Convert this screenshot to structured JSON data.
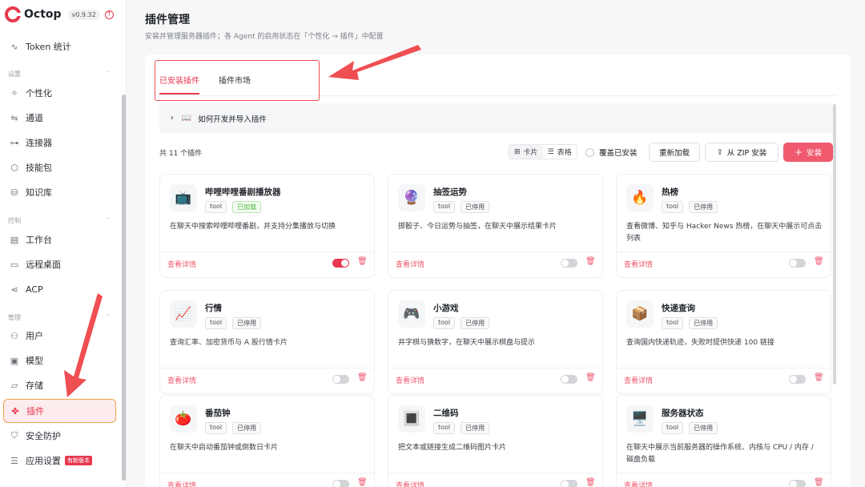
{
  "app": {
    "name": "Octop",
    "version": "v0.9.32"
  },
  "sidebar": {
    "token_item": {
      "label": "Token 统计",
      "icon": "activity-icon"
    },
    "groups": {
      "settings": "设置",
      "control": "控制",
      "manage": "管理"
    },
    "settings_items": [
      {
        "label": "个性化",
        "icon": "sparkle-icon"
      },
      {
        "label": "通道",
        "icon": "route-icon"
      },
      {
        "label": "连接器",
        "icon": "link-icon"
      },
      {
        "label": "技能包",
        "icon": "box-icon"
      },
      {
        "label": "知识库",
        "icon": "database-icon"
      }
    ],
    "control_items": [
      {
        "label": "工作台",
        "icon": "layout-icon"
      },
      {
        "label": "远程桌面",
        "icon": "monitor-icon"
      },
      {
        "label": "ACP",
        "icon": "share-icon"
      }
    ],
    "manage_items": [
      {
        "label": "用户",
        "icon": "users-icon"
      },
      {
        "label": "模型",
        "icon": "cube-icon"
      },
      {
        "label": "存储",
        "icon": "folder-icon"
      },
      {
        "label": "插件",
        "icon": "puzzle-icon"
      },
      {
        "label": "安全防护",
        "icon": "shield-icon"
      },
      {
        "label": "应用设置",
        "icon": "sliders-icon"
      }
    ],
    "new_version_badge": "有新版本"
  },
  "page": {
    "title": "插件管理",
    "subtitle": "安装并管理服务器插件；各 Agent 的启用状态在「个性化 → 插件」中配置"
  },
  "tabs": [
    "已安装插件",
    "插件市场"
  ],
  "howto": "如何开发并导入插件",
  "toolbar": {
    "count": "共 11 个插件",
    "view_card": "卡片",
    "view_table": "表格",
    "overwrite": "覆盖已安装",
    "reload": "重新加载",
    "zip_install": "从 ZIP 安装",
    "install": "安装"
  },
  "card_common": {
    "detail": "查看详情",
    "tool": "tool"
  },
  "plugins": [
    {
      "emoji": "📺",
      "name": "哔哩哔哩番剧播放器",
      "status": "已加载",
      "enabled": true,
      "desc": "在聊天中搜索哔哩哔哩番剧，并支持分集播放与切换"
    },
    {
      "emoji": "🔮",
      "name": "抽签运势",
      "status": "已停用",
      "enabled": false,
      "desc": "掷骰子、今日运势与抽签，在聊天中展示结果卡片"
    },
    {
      "emoji": "🔥",
      "name": "热榜",
      "status": "已停用",
      "enabled": false,
      "desc": "查看微博、知乎与 Hacker News 热榜，在聊天中展示可点击列表"
    },
    {
      "emoji": "📈",
      "name": "行情",
      "status": "已停用",
      "enabled": false,
      "desc": "查询汇率、加密货币与 A 股行情卡片"
    },
    {
      "emoji": "🎮",
      "name": "小游戏",
      "status": "已停用",
      "enabled": false,
      "desc": "井字棋与猜数字，在聊天中展示棋盘与提示"
    },
    {
      "emoji": "📦",
      "name": "快递查询",
      "status": "已停用",
      "enabled": false,
      "desc": "查询国内快递轨迹，失败时提供快递 100 链接"
    },
    {
      "emoji": "🍅",
      "name": "番茄钟",
      "status": "已停用",
      "enabled": false,
      "desc": "在聊天中启动番茄钟或倒数日卡片"
    },
    {
      "emoji": "🔳",
      "name": "二维码",
      "status": "已停用",
      "enabled": false,
      "desc": "把文本或链接生成二维码图片卡片"
    },
    {
      "emoji": "🖥️",
      "name": "服务器状态",
      "status": "已停用",
      "enabled": false,
      "desc": "在聊天中展示当前服务器的操作系统、内核与 CPU / 内存 / 磁盘负载"
    }
  ],
  "colors": {
    "accent": "#e7384e",
    "annotation": "#ef4e52",
    "highlight_border": "#f0a046"
  }
}
